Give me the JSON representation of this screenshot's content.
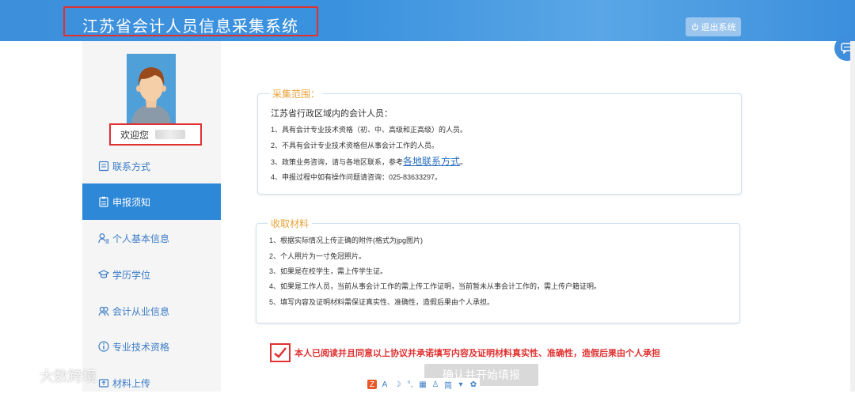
{
  "header": {
    "title": "江苏省会计人员信息采集系统",
    "logout_label": "退出系统"
  },
  "sidebar": {
    "welcome_label": "欢迎您",
    "items": [
      {
        "label": "联系方式",
        "icon": "contact-card-icon",
        "active": false
      },
      {
        "label": "申报须知",
        "icon": "clipboard-icon",
        "active": true
      },
      {
        "label": "个人基本信息",
        "icon": "person-list-icon",
        "active": false
      },
      {
        "label": "学历学位",
        "icon": "graduation-cap-icon",
        "active": false
      },
      {
        "label": "会计从业信息",
        "icon": "people-icon",
        "active": false
      },
      {
        "label": "专业技术资格",
        "icon": "info-circle-icon",
        "active": false
      },
      {
        "label": "材料上传",
        "icon": "upload-icon",
        "active": false
      }
    ]
  },
  "scope": {
    "legend": "采集范围：",
    "lines": [
      "江苏省行政区域内的会计人员：",
      "1、具有会计专业技术资格（初、中、高级和正高级）的人员。",
      "2、不具有会计专业技术资格但从事会计工作的人员。",
      "3、政策业务咨询，请与各地区联系，参考",
      "4、申报过程中如有操作问题请咨询：025-83633297。"
    ],
    "link_text": "各地联系方式",
    "link_suffix": "。"
  },
  "materials": {
    "legend": "收取材料",
    "lines": [
      "1、根据实际情况上传正确的附件(格式为jpg图片)",
      "2、个人照片为一寸免冠照片。",
      "3、如果是在校学生，需上传学生证。",
      "4、如果是工作人员，当前从事会计工作的需上传工作证明，当前暂未从事会计工作的，需上传户籍证明。",
      "5、填写内容及证明材料需保证真实性、准确性，造假后果由个人承担。"
    ]
  },
  "agreement": {
    "checked": true,
    "text": "本人已阅读并且同意以上协议并承诺填写内容及证明材料真实性、准确性，造假后果由个人承担"
  },
  "confirm_button": "确认并开始填报",
  "toolbar": {
    "letter": "A",
    "simplified": "简"
  },
  "watermark": "大数跨境",
  "colors": {
    "header_blue": "#3a92de",
    "active_nav": "#2e88d8",
    "alert_red": "#e03030",
    "legend_orange": "#e8a23a"
  }
}
